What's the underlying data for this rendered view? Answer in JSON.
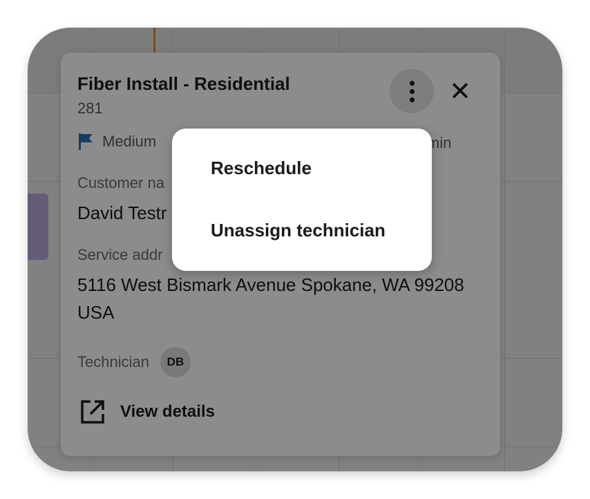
{
  "card": {
    "title": "Fiber Install - Residential",
    "subtitle": "281",
    "priority_label": "Medium",
    "duration_label": "min",
    "customer_label": "Customer na",
    "customer_value": "David Testr",
    "address_label": "Service addr",
    "address_value": "5116 West Bismark Avenue Spokane, WA 99208 USA",
    "technician_label": "Technician",
    "technician_initials": "DB",
    "view_details_label": "View details"
  },
  "menu": {
    "items": [
      {
        "label": "Reschedule"
      },
      {
        "label": "Unassign technician"
      }
    ]
  },
  "colors": {
    "flag": "#2f6fb0",
    "accent_now_line": "#e08a3a",
    "event_block": "#b7a6dc"
  },
  "icons": {
    "more": "more-vertical-icon",
    "close": "close-icon",
    "priority": "flag-icon",
    "view_details": "external-link-icon"
  }
}
